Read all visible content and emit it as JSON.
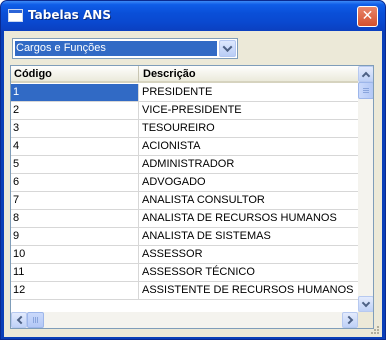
{
  "window": {
    "title": "Tabelas ANS",
    "close_label": "✕"
  },
  "combo": {
    "selected": "Cargos e Funções"
  },
  "grid": {
    "columns": [
      "Código",
      "Descrição"
    ],
    "selected_row": 0,
    "rows": [
      [
        "1",
        "PRESIDENTE"
      ],
      [
        "2",
        "VICE-PRESIDENTE"
      ],
      [
        "3",
        "TESOUREIRO"
      ],
      [
        "4",
        "ACIONISTA"
      ],
      [
        "5",
        "ADMINISTRADOR"
      ],
      [
        "6",
        "ADVOGADO"
      ],
      [
        "7",
        "ANALISTA CONSULTOR"
      ],
      [
        "8",
        "ANALISTA DE RECURSOS HUMANOS"
      ],
      [
        "9",
        "ANALISTA DE SISTEMAS"
      ],
      [
        "10",
        "ASSESSOR"
      ],
      [
        "11",
        "ASSESSOR TÉCNICO"
      ],
      [
        "12",
        "ASSISTENTE DE RECURSOS HUMANOS"
      ]
    ]
  }
}
